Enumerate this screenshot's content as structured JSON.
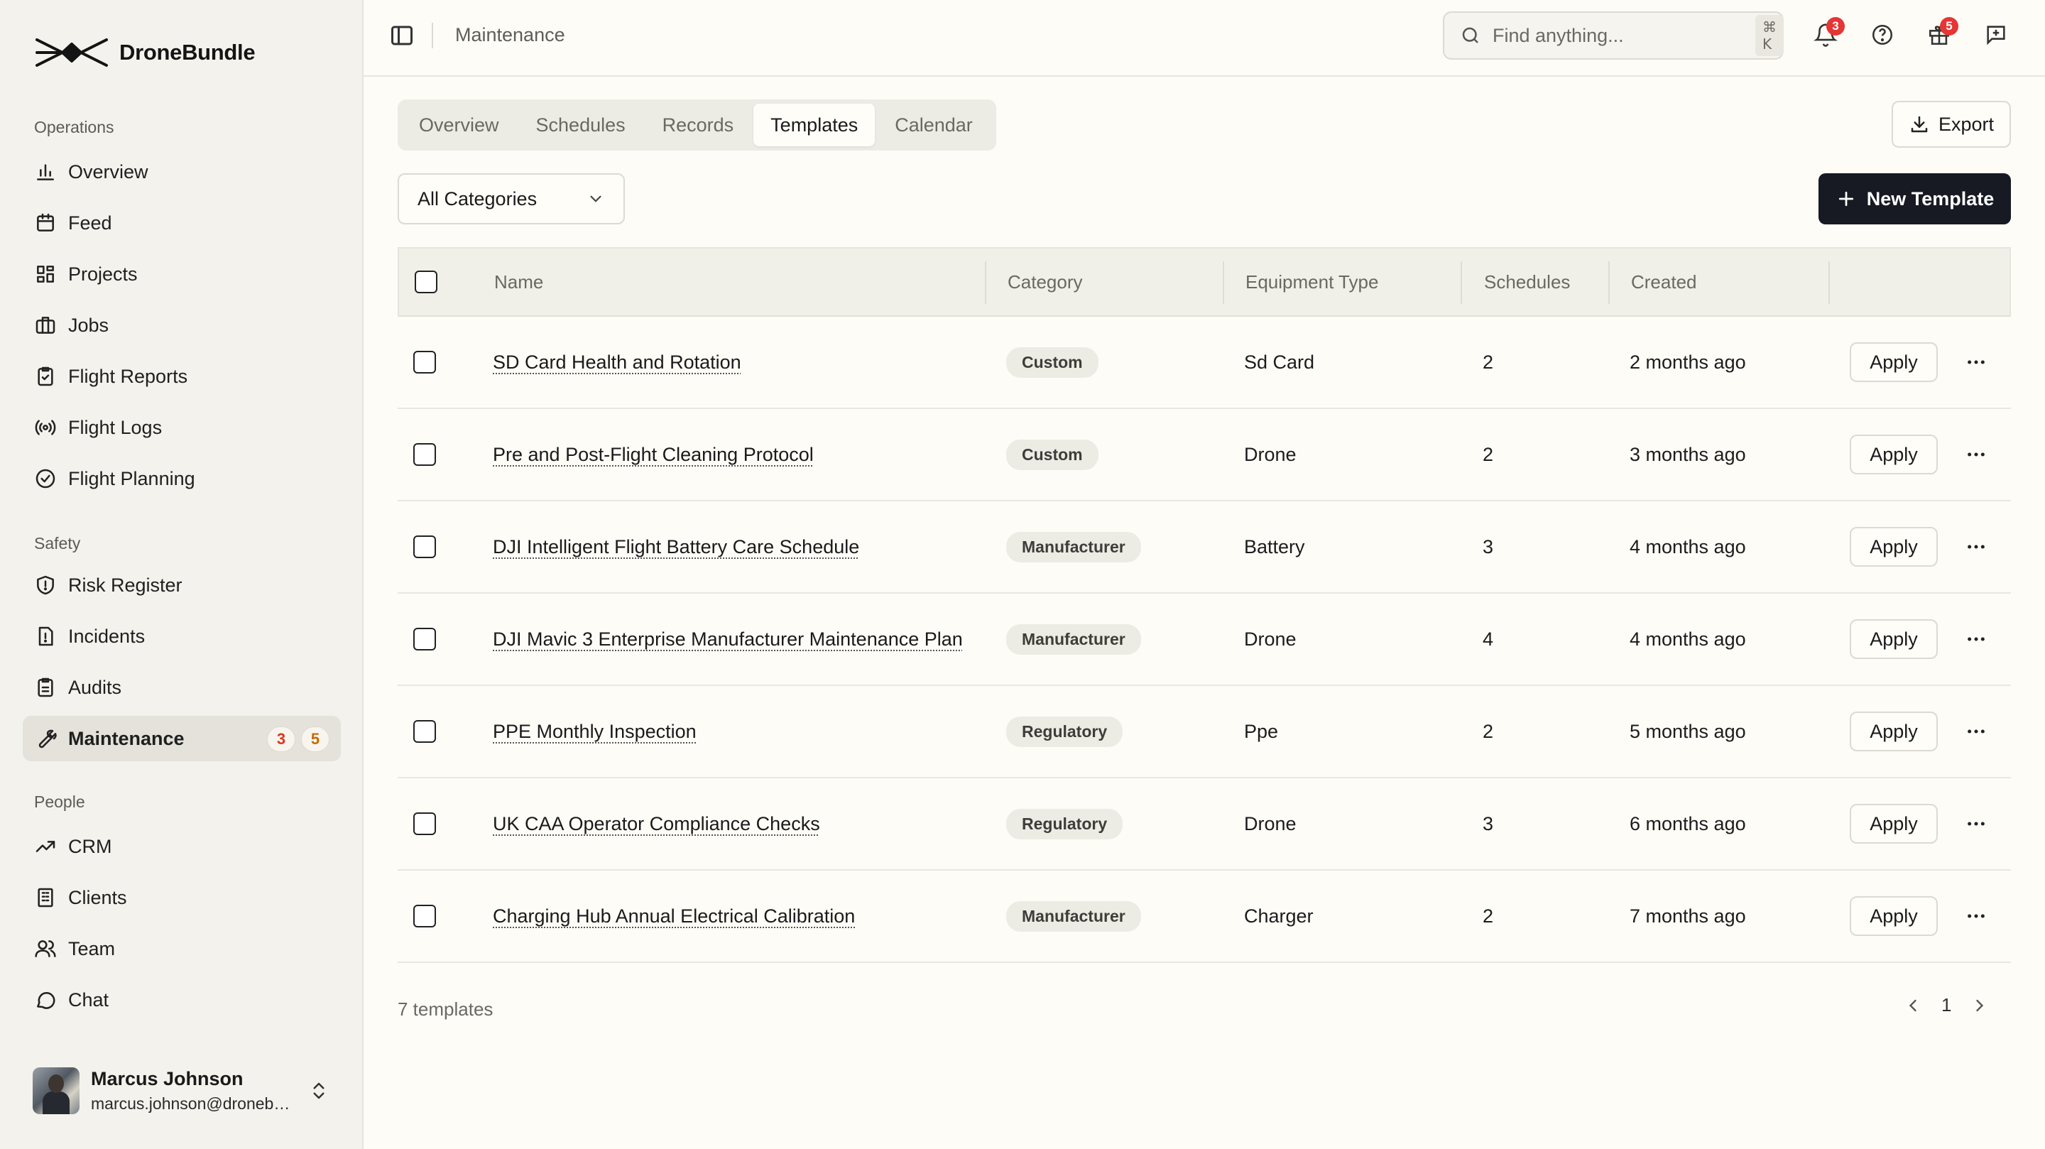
{
  "app": {
    "brand_name": "DroneBundle",
    "page_title": "Maintenance"
  },
  "sidebar": {
    "sections": [
      {
        "title": "Operations",
        "items": [
          {
            "label": "Overview",
            "icon": "bar-chart-icon"
          },
          {
            "label": "Feed",
            "icon": "calendar-icon"
          },
          {
            "label": "Projects",
            "icon": "layout-grid-icon"
          },
          {
            "label": "Jobs",
            "icon": "briefcase-icon"
          },
          {
            "label": "Flight Reports",
            "icon": "clipboard-check-icon"
          },
          {
            "label": "Flight Logs",
            "icon": "radio-icon"
          },
          {
            "label": "Flight Planning",
            "icon": "circle-check-icon"
          }
        ]
      },
      {
        "title": "Safety",
        "items": [
          {
            "label": "Risk Register",
            "icon": "shield-alert-icon"
          },
          {
            "label": "Incidents",
            "icon": "file-warning-icon"
          },
          {
            "label": "Audits",
            "icon": "clipboard-list-icon"
          },
          {
            "label": "Maintenance",
            "icon": "wrench-icon",
            "active": true,
            "badges": [
              "3",
              "5"
            ]
          }
        ]
      },
      {
        "title": "People",
        "items": [
          {
            "label": "CRM",
            "icon": "trending-up-icon"
          },
          {
            "label": "Clients",
            "icon": "building-icon"
          },
          {
            "label": "Team",
            "icon": "users-icon"
          },
          {
            "label": "Chat",
            "icon": "message-circle-icon"
          }
        ]
      }
    ],
    "user": {
      "name": "Marcus Johnson",
      "email": "marcus.johnson@dronebundle.com"
    }
  },
  "topbar": {
    "search_placeholder": "Find anything...",
    "search_shortcut": "⌘ K",
    "notifications_count": "3",
    "gifts_count": "5"
  },
  "tabs": [
    "Overview",
    "Schedules",
    "Records",
    "Templates",
    "Calendar"
  ],
  "active_tab": "Templates",
  "toolbar": {
    "export_label": "Export",
    "category_filter": "All Categories",
    "new_template_label": "New Template"
  },
  "table": {
    "columns": [
      "Name",
      "Category",
      "Equipment Type",
      "Schedules",
      "Created"
    ],
    "action_label": "Apply",
    "rows": [
      {
        "name": "SD Card Health and Rotation",
        "category": "Custom",
        "equipment": "Sd Card",
        "schedules": "2",
        "created": "2 months ago"
      },
      {
        "name": "Pre and Post-Flight Cleaning Protocol",
        "category": "Custom",
        "equipment": "Drone",
        "schedules": "2",
        "created": "3 months ago"
      },
      {
        "name": "DJI Intelligent Flight Battery Care Schedule",
        "category": "Manufacturer",
        "equipment": "Battery",
        "schedules": "3",
        "created": "4 months ago"
      },
      {
        "name": "DJI Mavic 3 Enterprise Manufacturer Maintenance Plan",
        "category": "Manufacturer",
        "equipment": "Drone",
        "schedules": "4",
        "created": "4 months ago"
      },
      {
        "name": "PPE Monthly Inspection",
        "category": "Regulatory",
        "equipment": "Ppe",
        "schedules": "2",
        "created": "5 months ago"
      },
      {
        "name": "UK CAA Operator Compliance Checks",
        "category": "Regulatory",
        "equipment": "Drone",
        "schedules": "3",
        "created": "6 months ago"
      },
      {
        "name": "Charging Hub Annual Electrical Calibration",
        "category": "Manufacturer",
        "equipment": "Charger",
        "schedules": "2",
        "created": "7 months ago"
      }
    ]
  },
  "footer": {
    "count_text": "7 templates",
    "page": "1"
  }
}
